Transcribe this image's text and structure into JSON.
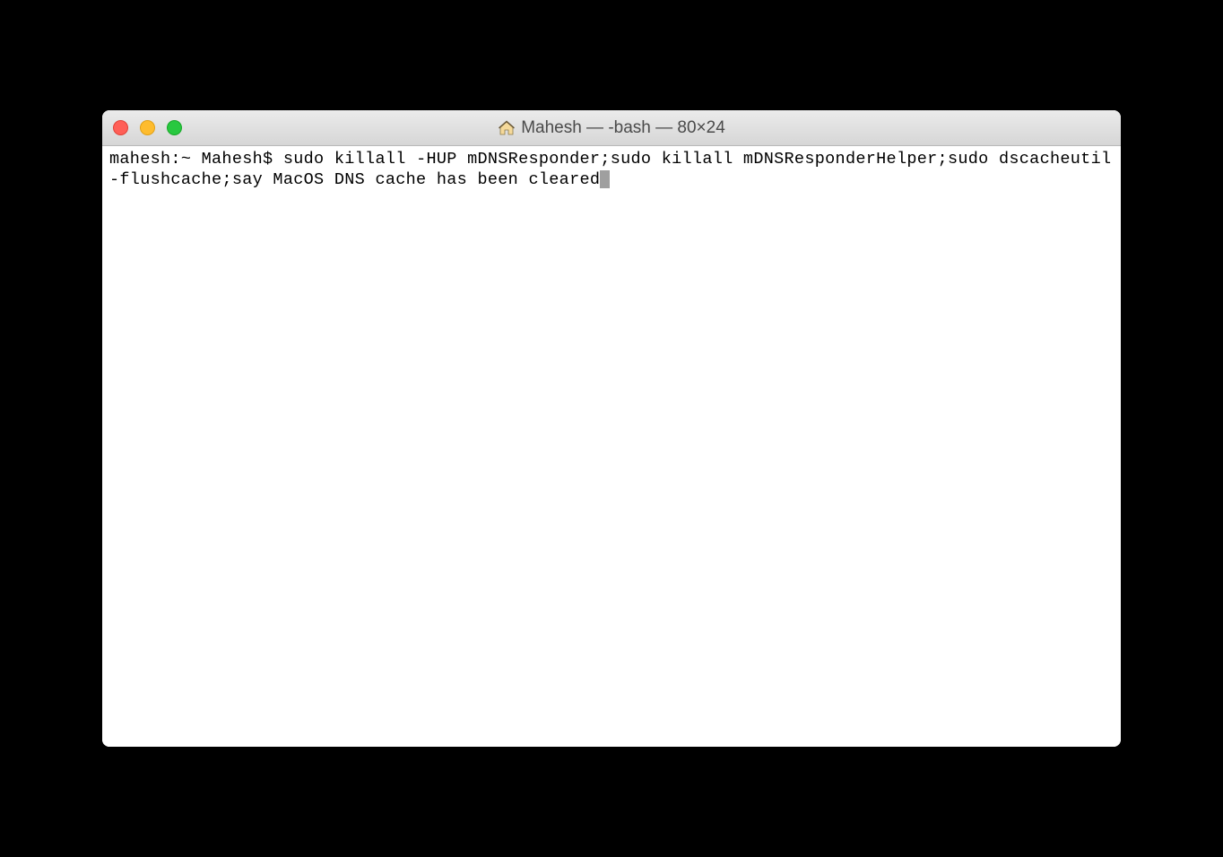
{
  "window": {
    "title": "Mahesh — -bash — 80×24"
  },
  "terminal": {
    "prompt": "mahesh:~ Mahesh$ ",
    "command": "sudo killall -HUP mDNSResponder;sudo killall mDNSResponderHelper;sudo dscacheutil -flushcache;say MacOS DNS cache has been cleared"
  }
}
